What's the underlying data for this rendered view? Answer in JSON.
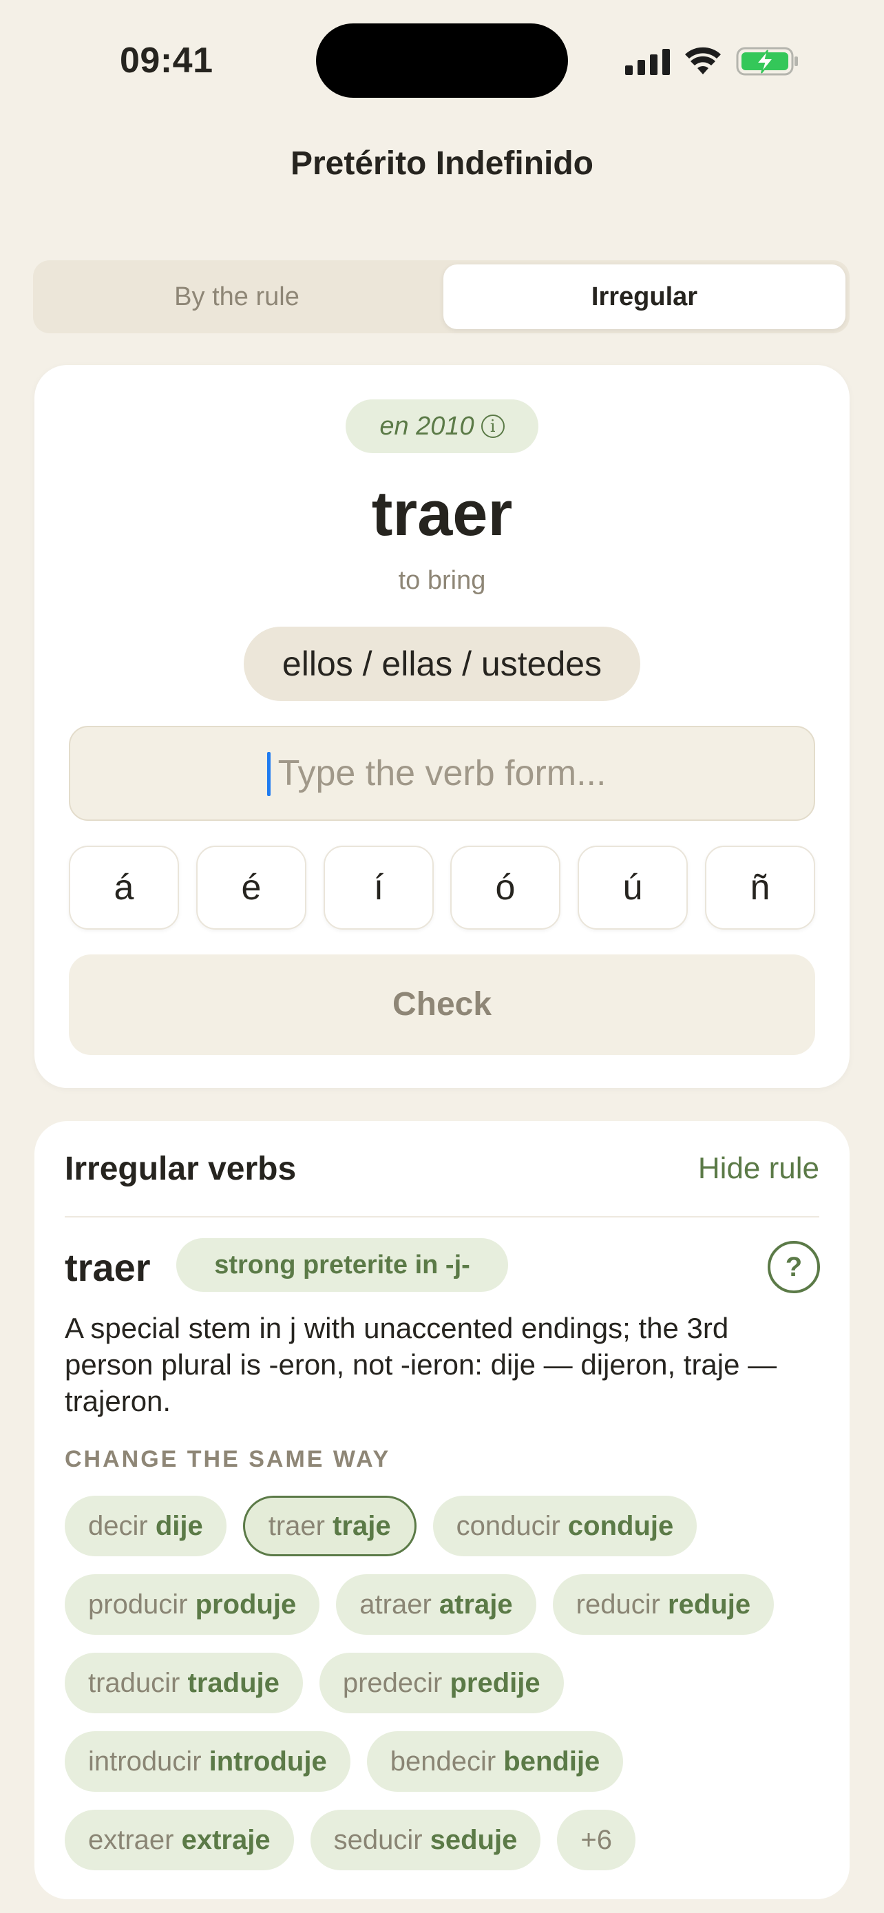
{
  "status_bar": {
    "time": "09:41"
  },
  "nav": {
    "title": "Pretérito Indefinido"
  },
  "segmented": {
    "options": [
      "By the rule",
      "Irregular"
    ],
    "selected": "Irregular"
  },
  "practice": {
    "hint_year": "en 2010",
    "verb": "traer",
    "translation": "to bring",
    "pronoun": "ellos / ellas / ustedes",
    "input": {
      "value": "",
      "placeholder": "Type the verb form..."
    },
    "accent_keys": [
      "á",
      "é",
      "í",
      "ó",
      "ú",
      "ñ"
    ],
    "check_label": "Check"
  },
  "rule": {
    "header": "Irregular verbs",
    "hide_label": "Hide rule",
    "verb": "traer",
    "tag": "strong preterite in -j-",
    "help_symbol": "?",
    "description": "A special stem in j with unaccented endings; the 3rd person plural is -eron, not -ieron: dije — dijeron, traje — trajeron.",
    "same_heading": "CHANGE THE SAME WAY",
    "examples": [
      {
        "infinitive": "decir",
        "form": "dije",
        "selected": false
      },
      {
        "infinitive": "traer",
        "form": "traje",
        "selected": true
      },
      {
        "infinitive": "conducir",
        "form": "conduje",
        "selected": false
      },
      {
        "infinitive": "producir",
        "form": "produje",
        "selected": false
      },
      {
        "infinitive": "atraer",
        "form": "atraje",
        "selected": false
      },
      {
        "infinitive": "reducir",
        "form": "reduje",
        "selected": false
      },
      {
        "infinitive": "traducir",
        "form": "traduje",
        "selected": false
      },
      {
        "infinitive": "predecir",
        "form": "predije",
        "selected": false
      },
      {
        "infinitive": "introducir",
        "form": "introduje",
        "selected": false
      },
      {
        "infinitive": "bendecir",
        "form": "bendije",
        "selected": false
      },
      {
        "infinitive": "extraer",
        "form": "extraje",
        "selected": false
      },
      {
        "infinitive": "seducir",
        "form": "seduje",
        "selected": false
      }
    ],
    "more_label": "+6"
  },
  "colors": {
    "background": "#F4F0E7",
    "accent_green": "#5B7A47",
    "chip_bg": "#E7EEDD",
    "caret": "#1E7BF0",
    "battery": "#34C759"
  }
}
